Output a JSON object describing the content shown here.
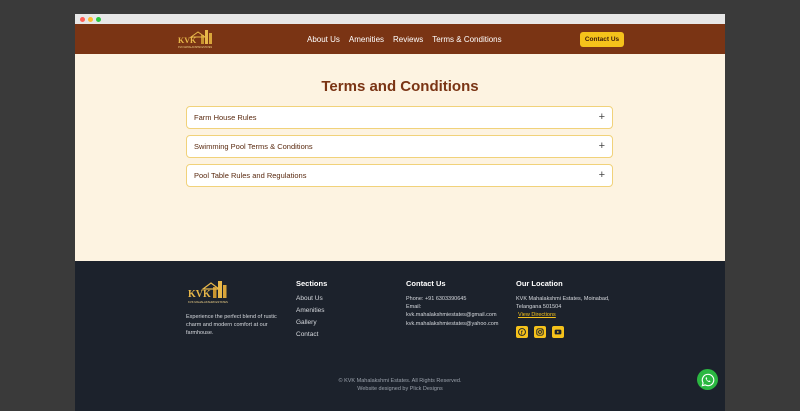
{
  "nav": {
    "links": [
      "About Us",
      "Amenities",
      "Reviews",
      "Terms & Conditions"
    ],
    "contact_label": "Contact Us",
    "logo_text": "KVK MAHALAKSHMI ESTATES"
  },
  "main": {
    "title": "Terms and Conditions",
    "items": [
      "Farm House Rules",
      "Swimming Pool Terms & Conditions",
      "Pool Table Rules and Regulations"
    ],
    "expand_icon": "+"
  },
  "footer": {
    "logo_text": "KVK MAHALAKSHMI ESTATES",
    "tagline": "Experience the perfect blend of rustic charm and modern comfort at our farmhouse.",
    "sections": {
      "heading": "Sections",
      "links": [
        "About Us",
        "Amenities",
        "Gallery",
        "Contact"
      ]
    },
    "contact": {
      "heading": "Contact Us",
      "phone": "Phone: +91 6303390645",
      "email_label": "Email:",
      "emails": [
        "kvk.mahalakshmiestates@gmail.com",
        "kvk.mahalakshmiestates@yahoo.com"
      ]
    },
    "location": {
      "heading": "Our Location",
      "address_line1": "KVK Mahalakshmi Estates, Moinabad,",
      "address_line2": "Telangana 501504",
      "directions": "View Directions",
      "social_icons": [
        "facebook-icon",
        "instagram-icon",
        "youtube-icon"
      ]
    },
    "copyright": "© KVK Mahalakshmi Estates. All Rights Reserved.",
    "credit": "Website designed by Plick Designs"
  },
  "colors": {
    "brand_brown": "#7a3414",
    "accent_yellow": "#f5c21b",
    "page_bg": "#fdf3e1",
    "footer_bg": "#1c222c",
    "whatsapp_green": "#2bb741"
  }
}
